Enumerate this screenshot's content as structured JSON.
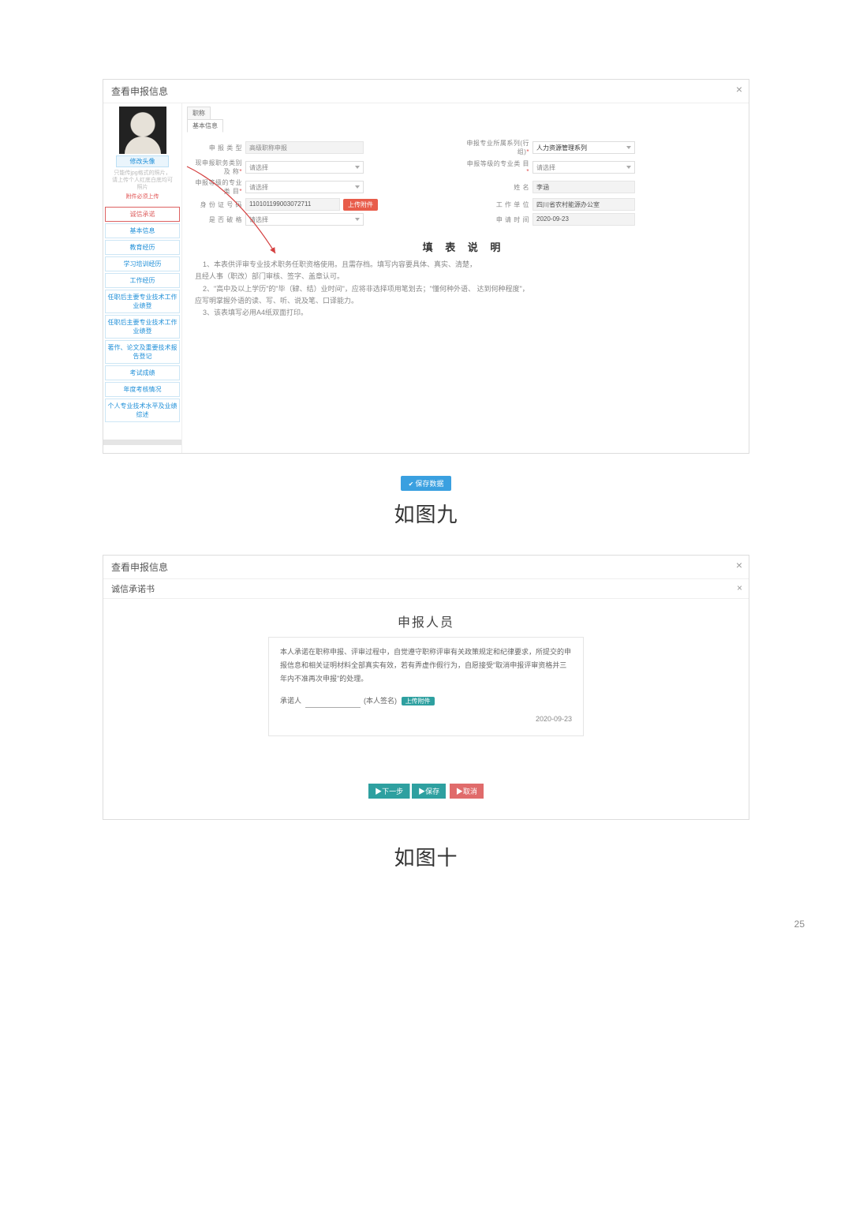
{
  "page_number": "25",
  "modal1": {
    "title": "查看申报信息",
    "close": "×",
    "sidebar": {
      "avatar_caption": "修改头像",
      "avatar_note": "只能传jpg格式的照片，请上传个人红底白底均可照片",
      "avatar_upload": "附件必须上传",
      "items": [
        "诚信承诺",
        "基本信息",
        "教育经历",
        "学习培训经历",
        "工作经历",
        "任职后主要专业技术工作业绩登",
        "任职后主要专业技术工作业绩登",
        "著作、论文及重要技术报告登记",
        "考试成绩",
        "年度考核情况",
        "个人专业技术水平及业绩综述"
      ],
      "active_index": 0
    },
    "tabs": {
      "t1": "职称",
      "t2": "基本信息"
    },
    "form": {
      "r1l_label": "申 报 类 型",
      "r1l_value": "高级职称申报",
      "r1r_label": "申报专业所属系列(行          组)",
      "r1r_value": "人力资源管理系列",
      "r2l_label": "现申报职务类别及          称",
      "r2l_value": "请选择",
      "r2r_label": "申报等级的专业类          目",
      "r2r_value": "请选择",
      "r3l_label": "申报等级的专业类          目",
      "r3l_value": "请选择",
      "r3r_label": "姓          名",
      "r3r_value": "李涵",
      "r4l_label": "身 份 证 号 码",
      "r4l_value": "110101199003072711",
      "r4l_btn": "上传附件",
      "r4r_label": "工 作 单 位",
      "r4r_value": "四川省农村能源办公室",
      "r5l_label": "是 否 破 格",
      "r5l_value": "请选择",
      "r5r_label": "申 请 时 间",
      "r5r_value": "2020-09-23"
    },
    "fill_title": "填 表 说 明",
    "instructions": {
      "l1": "1、本表供评审专业技术职务任职资格使用。且需存档。填写内容要具体、真实、清楚，",
      "l1b": "且经人事（职改）部门审核、签字、盖章认可。",
      "l2": "2、\"高中及以上学历\"的\"毕（肄、结）业时间\"，应将非选择项用笔划去；\"懂何种外语、 达到何种程度\"，",
      "l2b": "应写明掌握外语的读、写、听、说及笔、口译能力。",
      "l3": "3、该表填写必用A4纸双面打印。"
    },
    "save_btn": "保存数据"
  },
  "caption1": "如图九",
  "modal2": {
    "title": "查看申报信息",
    "close": "×",
    "inner_title": "诚信承诺书",
    "inner_close": "×",
    "declare_title": "申报人员",
    "declare_body": "本人承诺在职称申报、评审过程中，自觉遵守职称评审有关政策规定和纪律要求，所提交的申报信息和相关证明材料全部真实有效，若有弄虚作假行为，自愿接受\"取消申报评审资格并三年内不准再次申报\"的处理。",
    "sign_label": "承诺人",
    "sign_suffix": "(本人签名)",
    "sign_btn": "上传附件",
    "date": "2020-09-23",
    "btn_next": "▶下一步",
    "btn_save": "▶保存",
    "btn_cancel": "▶取消"
  },
  "caption2": "如图十"
}
